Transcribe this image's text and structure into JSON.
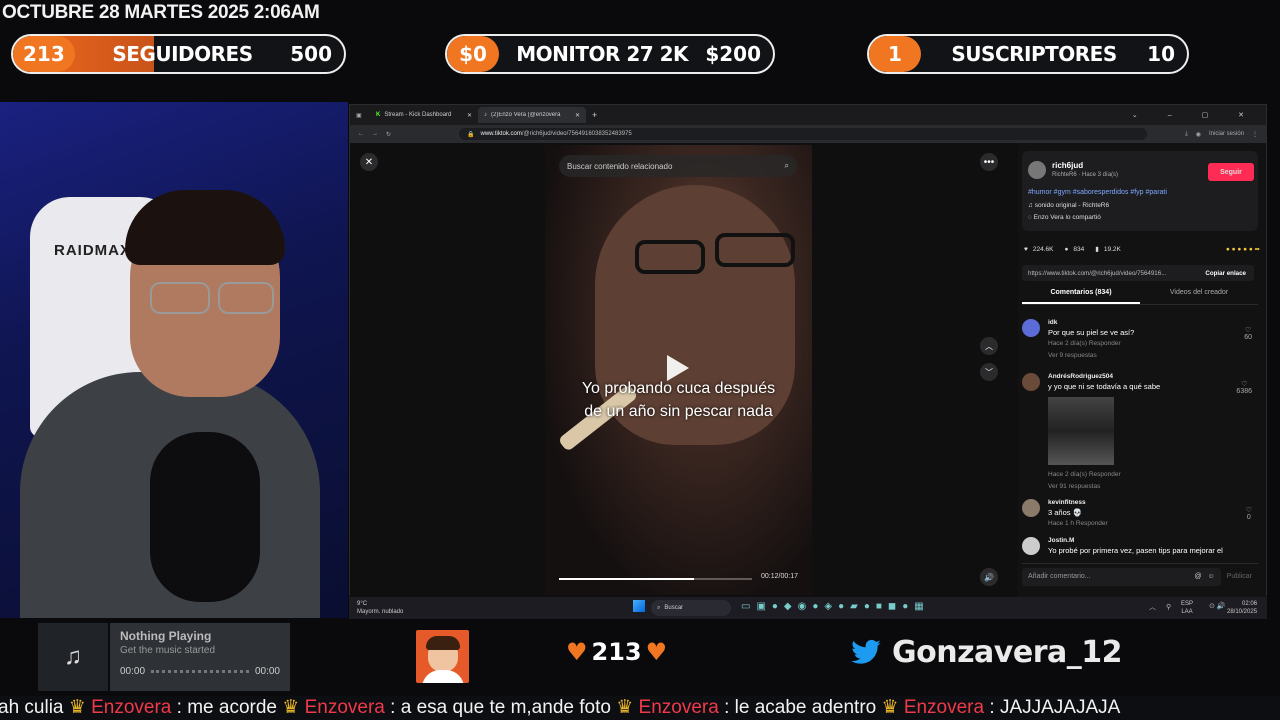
{
  "overlay": {
    "datetime": "OCTUBRE 28 MARTES 2025 2:06AM",
    "goals": [
      {
        "badge": "213",
        "label": "SEGUIDORES",
        "target": "500",
        "progress": 0.426
      },
      {
        "badge": "$0",
        "label": "MONITOR 27 2K",
        "target": "$200",
        "progress": 0.0
      },
      {
        "badge": "1",
        "label": "SUSCRIPTORES",
        "target": "10",
        "progress": 0.1
      }
    ]
  },
  "webcam": {
    "chair_brand": "RAIDMAX"
  },
  "browser": {
    "tabs": [
      {
        "label": "Stream - Kick Dashboard",
        "active": false
      },
      {
        "label": "(2)Enzo Vera (@enzovera14)",
        "active": true
      }
    ],
    "url_domain": "www.tiktok.com",
    "url_path": "/@rich6jud/video/7564916038352483975",
    "login_label": "Iniciar sesión"
  },
  "video": {
    "search_placeholder": "Buscar contenido relacionado",
    "caption_line1": "Yo probando cuca después",
    "caption_line2": "de un año sin pescar nada",
    "time": "00:12/00:17",
    "progress": 0.7
  },
  "post": {
    "author": "rich6jud",
    "author_sub": "RichteR6 · Hace 3 día(s)",
    "follow_label": "Seguir",
    "hashtags": "#humor #gym #saboresperdidos #fyp #parati",
    "sound": "sonido original - RichteR6",
    "shared_by": "Enzo Vera lo compartió",
    "likes": "224.6K",
    "comments_count": "834",
    "saves": "19.2K",
    "share_url": "https://www.tiktok.com/@rich6jud/video/7564916...",
    "copy_label": "Copiar enlace",
    "tab_comments": "Comentarios (834)",
    "tab_creator": "Videos del creador",
    "comments": [
      {
        "name": "idk",
        "text": "Por que su piel se ve así?",
        "meta": "Hace 2 día(s)     Responder",
        "likes": "60",
        "replies": "Ver 9 respuestas"
      },
      {
        "name": "AndrésRodriguez504",
        "text": "y yo que ni se todavía a qué sabe",
        "meta": "Hace 2 día(s)     Responder",
        "likes": "6386",
        "replies": "Ver 91 respuestas"
      },
      {
        "name": "kevinfitness",
        "text": "3 años 💀",
        "meta": "Hace 1 h     Responder",
        "likes": "0",
        "replies": ""
      },
      {
        "name": "Jostin.M",
        "text": "Yo probé por primera vez, pasen tips para mejorar el",
        "meta": "",
        "likes": "",
        "replies": ""
      }
    ],
    "add_comment_placeholder": "Añadir comentario...",
    "publish_label": "Publicar"
  },
  "taskbar": {
    "weather_temp": "9°C",
    "weather_desc": "Mayorm. nublado",
    "search_label": "Buscar",
    "lang": "ESP",
    "lang2": "LAA",
    "clock_time": "02:06",
    "clock_date": "28/10/2025"
  },
  "music": {
    "title": "Nothing Playing",
    "subtitle": "Get the music started",
    "time_start": "00:00",
    "time_end": "00:00"
  },
  "follower_count": "213",
  "twitter_handle": "Gonzavera_12",
  "chat_ticker": [
    {
      "user": "",
      "text": "ah culia"
    },
    {
      "user": "Enzovera",
      "text": "me acorde"
    },
    {
      "user": "Enzovera",
      "text": "a esa que te m,ande foto"
    },
    {
      "user": "Enzovera",
      "text": "le acabe adentro"
    },
    {
      "user": "Enzovera",
      "text": "JAJJAJAJAJA"
    }
  ],
  "colors": {
    "accent_orange": "#f07622",
    "follow_red": "#fe2c55",
    "chat_user": "#f0394a",
    "twitter_blue": "#1d9bf0"
  }
}
